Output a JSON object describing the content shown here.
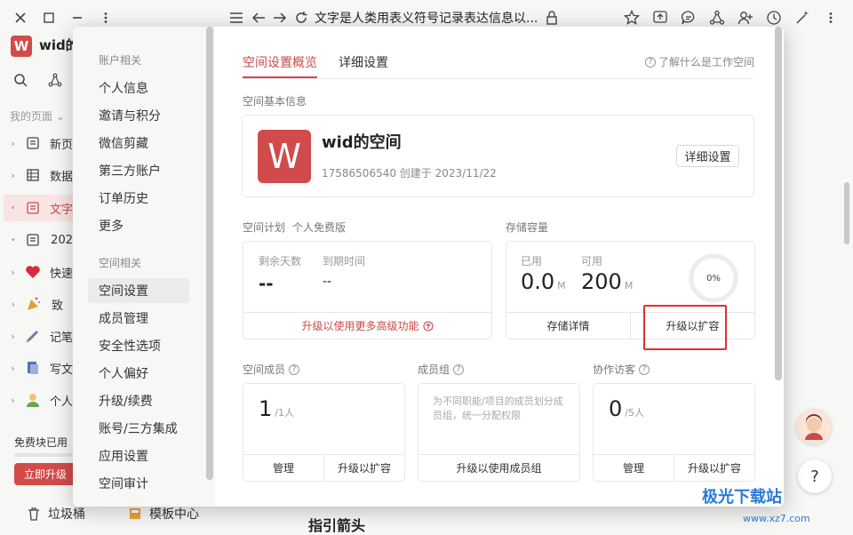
{
  "topbar": {
    "title": "文字是人类用表义符号记录表达信息以..."
  },
  "workspace": {
    "logo_letter": "W",
    "name": "wid的"
  },
  "sidebar": {
    "my_pages": "我的页面",
    "items": [
      {
        "label": "新页",
        "icon": "doc-icon"
      },
      {
        "label": "数据",
        "icon": "table-icon"
      },
      {
        "label": "文字",
        "icon": "doc-icon"
      },
      {
        "label": "202",
        "icon": "doc-icon"
      },
      {
        "label": "快速",
        "icon": "heart-icon"
      },
      {
        "label": "致",
        "icon": "party-icon"
      },
      {
        "label": "记笔",
        "icon": "pen-icon"
      },
      {
        "label": "写文",
        "icon": "paper-icon"
      },
      {
        "label": "个人",
        "icon": "person-icon"
      }
    ],
    "free_blocks": "免费块已用",
    "upgrade_now": "立即升级"
  },
  "bottombar": {
    "trash": "垃圾桶",
    "templates": "模板中心",
    "guide": "指引箭头",
    "help": "?"
  },
  "modal": {
    "nav": {
      "section_account": "账户相关",
      "account_items": [
        "个人信息",
        "邀请与积分",
        "微信剪藏",
        "第三方账户",
        "订单历史",
        "更多"
      ],
      "section_space": "空间相关",
      "space_items": [
        "空间设置",
        "成员管理",
        "安全性选项",
        "个人偏好",
        "升级/续费",
        "账号/三方集成",
        "应用设置",
        "空间审计"
      ],
      "active": "空间设置"
    },
    "tabs": [
      "空间设置概览",
      "详细设置"
    ],
    "help_link": "了解什么是工作空间",
    "basic_info_label": "空间基本信息",
    "space": {
      "logo_letter": "W",
      "name": "wid的空间",
      "meta": "17586506540 创建于 2023/11/22",
      "detail_button": "详细设置"
    },
    "plan": {
      "label": "空间计划",
      "plan_name": "个人免费版",
      "remaining_days_label": "剩余天数",
      "remaining_days": "--",
      "expire_label": "到期时间",
      "expire": "--",
      "upgrade_link": "升级以使用更多高级功能"
    },
    "storage": {
      "label": "存储容量",
      "used_label": "已用",
      "used": "0.0",
      "used_unit": "M",
      "avail_label": "可用",
      "avail": "200",
      "avail_unit": "M",
      "percent": "0%",
      "details_btn": "存储详情",
      "upgrade_btn": "升级以扩容"
    },
    "members": {
      "label": "空间成员",
      "count": "1",
      "limit": "/1人",
      "manage_btn": "管理",
      "upgrade_btn": "升级以扩容"
    },
    "groups": {
      "label": "成员组",
      "desc": "为不同职能/项目的成员划分成员组，统一分配权限",
      "upgrade_btn": "升级以使用成员组"
    },
    "guests": {
      "label": "协作访客",
      "count": "0",
      "limit": "/5人",
      "manage_btn": "管理",
      "upgrade_btn": "升级以扩容"
    }
  },
  "watermark": {
    "text": "极光下载站",
    "sub": "www.xz7.com"
  },
  "colors": {
    "accent": "#c94a4a",
    "logo": "#d24b4b",
    "highlight": "#e03030"
  }
}
